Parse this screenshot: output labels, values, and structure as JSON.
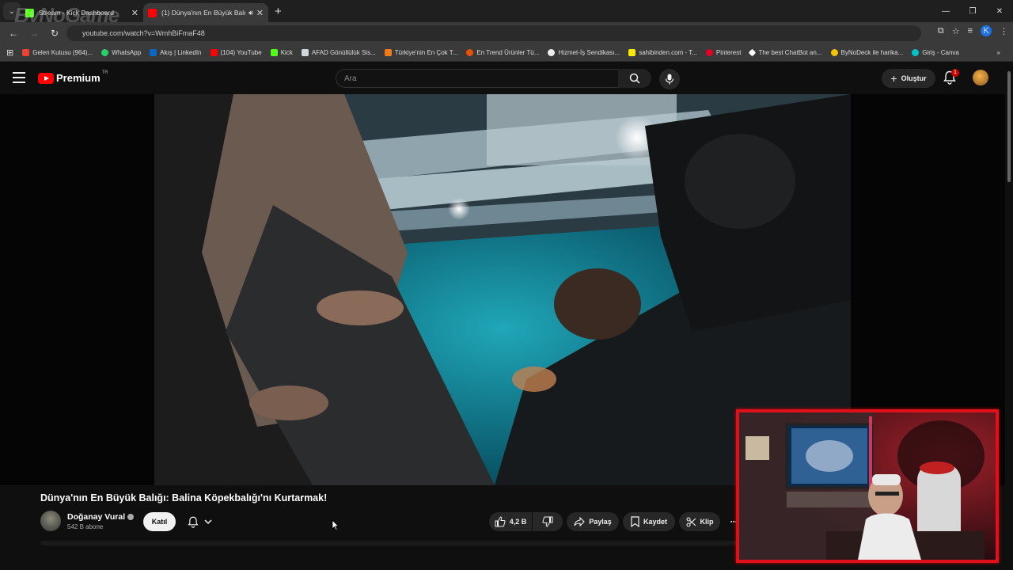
{
  "browser": {
    "tabs": [
      {
        "title": "Stream - Kick Dashboard",
        "active": false,
        "favicon_color": "#53fc18"
      },
      {
        "title": "(1) Dünya'nın En Büyük Balı",
        "active": true,
        "favicon_color": "#ff0000"
      }
    ],
    "watermark": "ByNoGame",
    "url": "youtube.com/watch?v=WmhBiFmaF48",
    "profile_initial": "K",
    "bookmarks": [
      {
        "label": "Gelen Kutusu (964)...",
        "color": "#ea4335"
      },
      {
        "label": "WhatsApp",
        "color": "#25d366"
      },
      {
        "label": "Akış | LinkedIn",
        "color": "#0a66c2"
      },
      {
        "label": "(104) YouTube",
        "color": "#ff0000"
      },
      {
        "label": "Kick",
        "color": "#53fc18"
      },
      {
        "label": "AFAD Gönüllülük Sis...",
        "color": "#cfd8dc"
      },
      {
        "label": "Türkiye'nin En Çok T...",
        "color": "#f27a1a"
      },
      {
        "label": "En Trend Ürünler Tü...",
        "color": "#e65100"
      },
      {
        "label": "Hizmet-İş Sendikası...",
        "color": "#eeeeee"
      },
      {
        "label": "sahibinden.com - T...",
        "color": "#ffe800"
      },
      {
        "label": "Pinterest",
        "color": "#e60023"
      },
      {
        "label": "The best ChatBot an...",
        "color": "#ffffff"
      },
      {
        "label": "ByNoDeck ile harika...",
        "color": "#f5c400"
      },
      {
        "label": "Giriş - Canva",
        "color": "#00c4cc"
      }
    ]
  },
  "youtube": {
    "logo_text": "Premium",
    "region": "TR",
    "search_placeholder": "Ara",
    "create_label": "Oluştur",
    "notification_count": "1"
  },
  "video": {
    "title": "Dünya'nın En Büyük Balığı: Balina Köpekbalığı'nı Kurtarmak!",
    "channel": "Doğanay Vural",
    "subscribers": "542 B abone",
    "join_label": "Katıl",
    "likes": "4,2 B",
    "share_label": "Paylaş",
    "save_label": "Kaydet",
    "clip_label": "Klip"
  },
  "colors": {
    "accent": "#ff0000",
    "webcam_border": "#e0101a"
  }
}
